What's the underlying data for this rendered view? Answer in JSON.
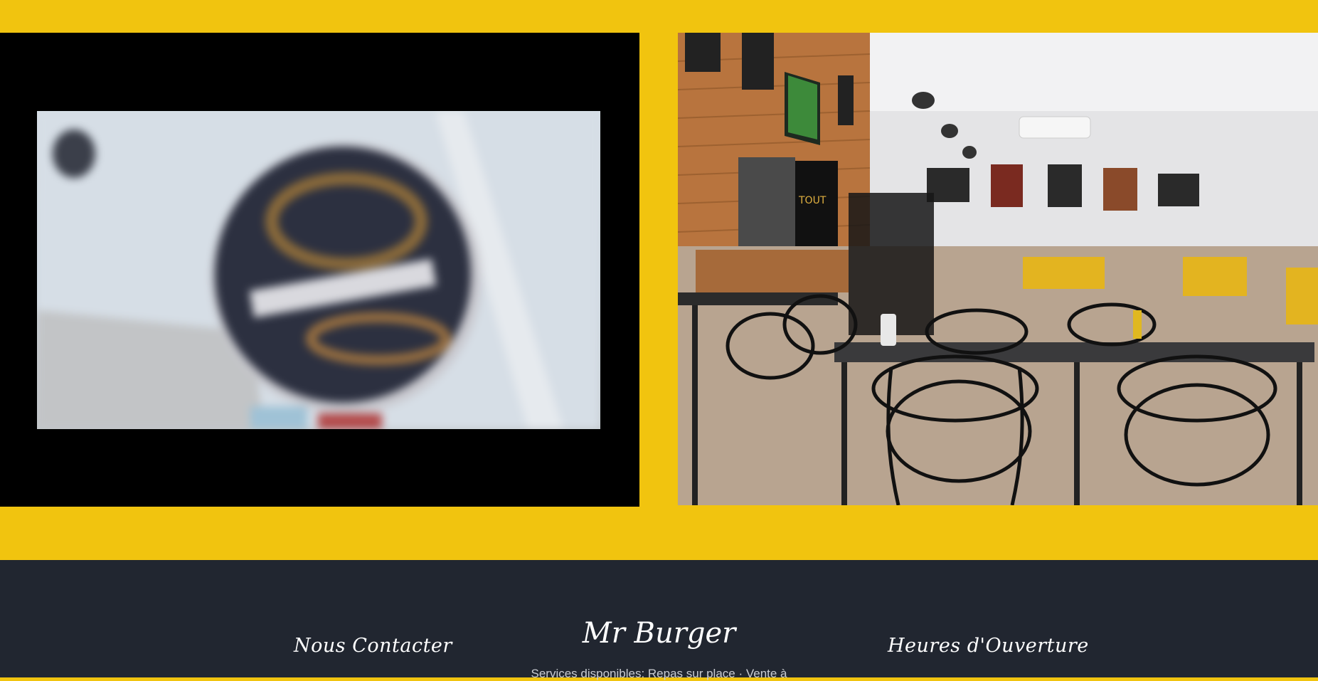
{
  "gallery": {
    "left_media": {
      "icon": "blurred-logo-video"
    },
    "right_media": {
      "icon": "restaurant-interior-photo"
    },
    "background_color": "#f1c40f"
  },
  "footer": {
    "background_color": "#212630",
    "contact_heading": "Nous Contacter",
    "brand_title": "Mr Burger",
    "services_text": "Services disponibles: Repas sur place · Vente à",
    "hours_heading": "Heures d'Ouverture"
  }
}
